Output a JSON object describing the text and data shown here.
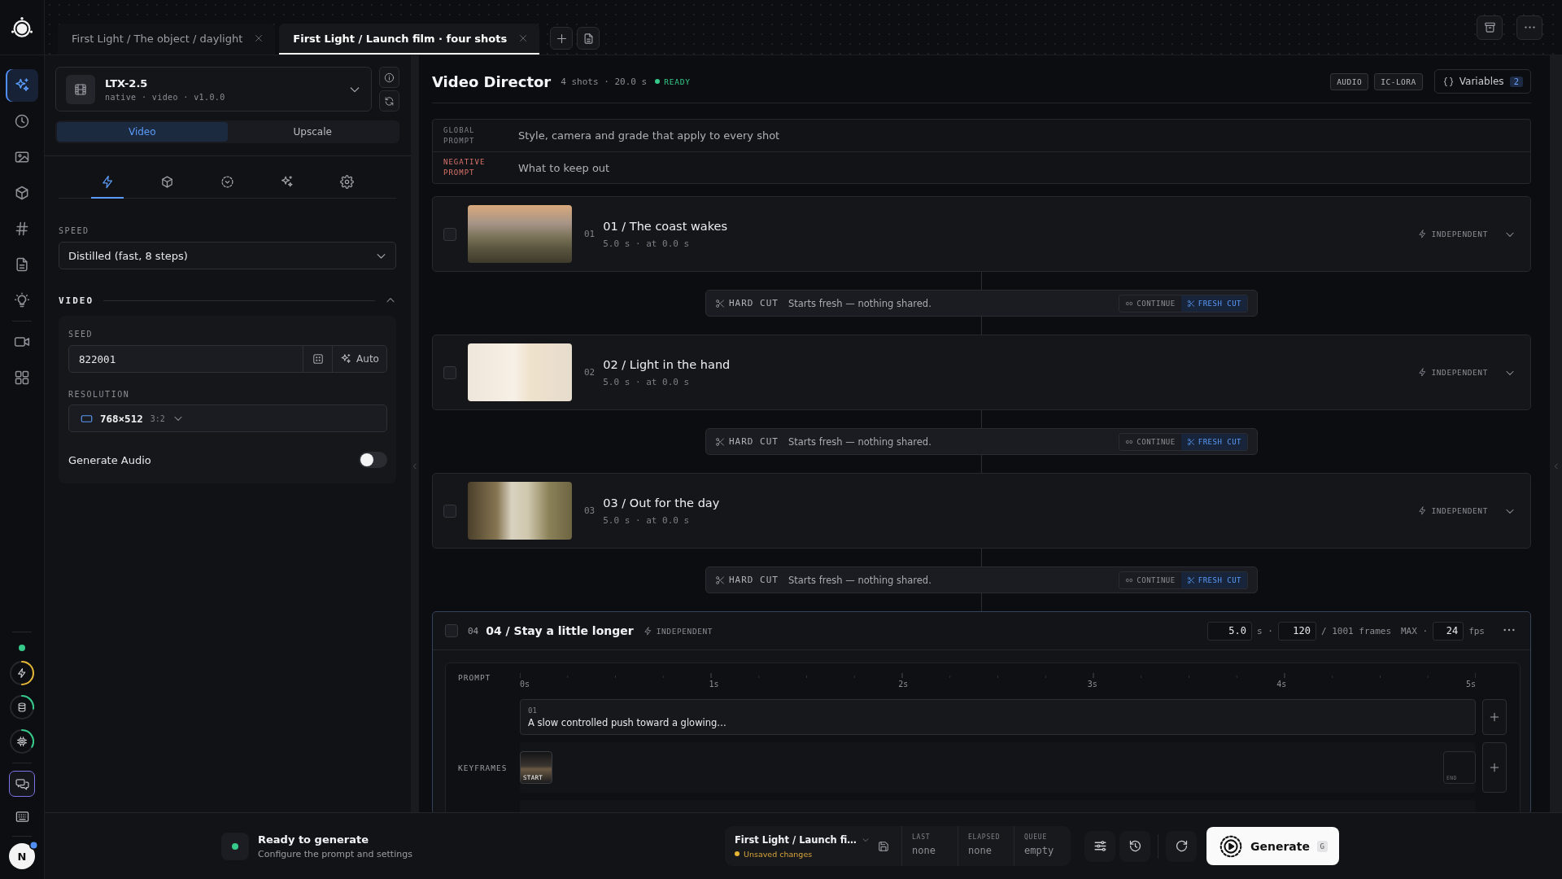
{
  "rail": {
    "items": [
      {
        "selected": true
      },
      {
        "selected": false
      },
      {
        "selected": false
      },
      {
        "selected": false
      },
      {
        "selected": false
      },
      {
        "selected": false
      },
      {
        "selected": false
      },
      {
        "selected": false
      },
      {
        "selected": false
      }
    ],
    "online": true,
    "tools": [
      {
        "selected": true
      },
      {
        "selected": false
      }
    ],
    "avatar": {
      "initial": "N",
      "notification": true
    }
  },
  "tabs": [
    {
      "label": "First Light / The object / daylight",
      "selected": false
    },
    {
      "label": "First Light / Launch film · four shots",
      "selected": true
    }
  ],
  "model": {
    "name": "LTX-2.5",
    "meta": "native · video · v1.0.0"
  },
  "mode_tabs": [
    {
      "label": "Video",
      "selected": true
    },
    {
      "label": "Upscale",
      "selected": false
    }
  ],
  "settings_tabs": [
    {
      "selected": true
    },
    {
      "selected": false
    },
    {
      "selected": false
    },
    {
      "selected": false
    },
    {
      "selected": false
    }
  ],
  "speed": {
    "label": "SPEED",
    "value": "Distilled (fast, 8 steps)"
  },
  "video": {
    "title": "VIDEO",
    "expanded": true,
    "seed": {
      "label": "SEED",
      "value": "822001",
      "auto": "Auto"
    },
    "resolution": {
      "label": "RESOLUTION",
      "value": "768×512",
      "aspect": "3:2"
    },
    "audio": {
      "label": "Generate Audio",
      "on": false
    }
  },
  "director": {
    "title": "Video Director",
    "summary": "4 shots · 20.0 s",
    "status": "READY",
    "badges": [
      "AUDIO",
      "IC-LORA"
    ],
    "variables": {
      "label": "Variables",
      "count": "2"
    }
  },
  "prompts": [
    {
      "kind": "global",
      "label": "GLOBAL PROMPT",
      "placeholder": "Style, camera and grade that apply to every shot"
    },
    {
      "kind": "negative",
      "label": "NEGATIVE PROMPT",
      "placeholder": "What to keep out"
    }
  ],
  "sequence": [
    {
      "kind": "shot",
      "checked": false,
      "expanded": false,
      "number": "01",
      "title": "01 / The coast wakes",
      "meta": "5.0 s · at 0.0 s",
      "mode": "INDEPENDENT"
    },
    {
      "kind": "cut",
      "label": "HARD CUT",
      "description": "Starts fresh — nothing shared.",
      "options": [
        {
          "label": "CONTINUE",
          "selected": false
        },
        {
          "label": "FRESH CUT",
          "selected": true
        }
      ]
    },
    {
      "kind": "shot",
      "checked": false,
      "expanded": false,
      "number": "02",
      "title": "02 / Light in the hand",
      "meta": "5.0 s · at 0.0 s",
      "mode": "INDEPENDENT"
    },
    {
      "kind": "cut",
      "label": "HARD CUT",
      "description": "Starts fresh — nothing shared.",
      "options": [
        {
          "label": "CONTINUE",
          "selected": false
        },
        {
          "label": "FRESH CUT",
          "selected": true
        }
      ]
    },
    {
      "kind": "shot",
      "checked": false,
      "expanded": false,
      "number": "03",
      "title": "03 / Out for the day",
      "meta": "5.0 s · at 0.0 s",
      "mode": "INDEPENDENT"
    },
    {
      "kind": "cut",
      "label": "HARD CUT",
      "description": "Starts fresh — nothing shared.",
      "options": [
        {
          "label": "CONTINUE",
          "selected": false
        },
        {
          "label": "FRESH CUT",
          "selected": true
        }
      ]
    },
    {
      "kind": "shot",
      "checked": false,
      "expanded": true,
      "number": "04",
      "title": "04 / Stay a little longer",
      "mode": "INDEPENDENT",
      "duration": "5.0",
      "duration_unit": "s ·",
      "frames": "120",
      "frames_total": "/ 1001 frames",
      "max_label": "MAX ·",
      "fps": "24",
      "fps_unit": "fps",
      "timeline": {
        "ticks": [
          "0s",
          "1s",
          "2s",
          "3s",
          "4s",
          "5s"
        ],
        "prompt": {
          "label": "PROMPT",
          "index": "01",
          "text": "A slow controlled push toward a glowing…"
        },
        "keyframes": {
          "label": "KEYFRAMES",
          "start": "START",
          "end": "END"
        }
      }
    }
  ],
  "footer": {
    "title": "Ready to generate",
    "subtitle": "Configure the prompt and settings",
    "project": {
      "name": "First Light / Launch fi…",
      "unsaved": true,
      "note": "Unsaved changes"
    },
    "stats": [
      {
        "label": "LAST",
        "value": "none"
      },
      {
        "label": "ELAPSED",
        "value": "none"
      },
      {
        "label": "QUEUE",
        "value": "empty"
      }
    ],
    "generate": {
      "label": "Generate",
      "shortcut": "G"
    }
  }
}
